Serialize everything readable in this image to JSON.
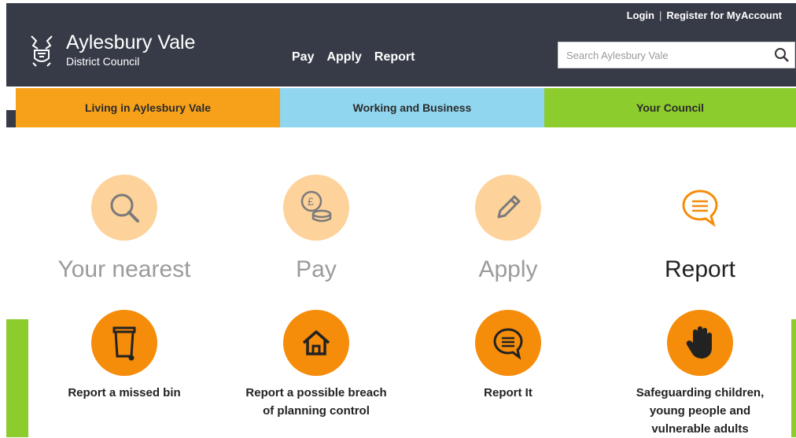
{
  "account": {
    "login": "Login",
    "separator": "|",
    "register": "Register for MyAccount"
  },
  "logo": {
    "title": "Aylesbury Vale",
    "subtitle": "District Council",
    "icon": "council-crest-icon"
  },
  "nav": {
    "items": [
      {
        "label": "Pay"
      },
      {
        "label": "Apply"
      },
      {
        "label": "Report"
      }
    ]
  },
  "search": {
    "placeholder": "Search Aylesbury Vale",
    "icon": "search-icon"
  },
  "sections": [
    {
      "label": "Living in Aylesbury Vale",
      "color": "#f7a11a"
    },
    {
      "label": "Working and Business",
      "color": "#8fd6ee"
    },
    {
      "label": "Your Council",
      "color": "#8ccc2d"
    }
  ],
  "quick_links": [
    {
      "label": "Your nearest",
      "icon": "magnifier-icon",
      "active": false
    },
    {
      "label": "Pay",
      "icon": "coins-icon",
      "active": false
    },
    {
      "label": "Apply",
      "icon": "pencil-icon",
      "active": false
    },
    {
      "label": "Report",
      "icon": "speech-bubble-icon",
      "active": true
    }
  ],
  "report_items": [
    {
      "label": "Report a missed bin",
      "icon": "bin-icon"
    },
    {
      "label": "Report a possible breach\nof planning control",
      "icon": "house-icon"
    },
    {
      "label": "Report It",
      "icon": "speech-bubble-icon"
    },
    {
      "label": "Safeguarding children,\nyoung people and\nvulnerable adults",
      "icon": "hand-icon"
    }
  ],
  "colors": {
    "header_bg": "#363b47",
    "accent_orange": "#f58c0a",
    "light_orange": "#fdd29b",
    "green": "#8ccc2d",
    "blue": "#8fd6ee"
  }
}
